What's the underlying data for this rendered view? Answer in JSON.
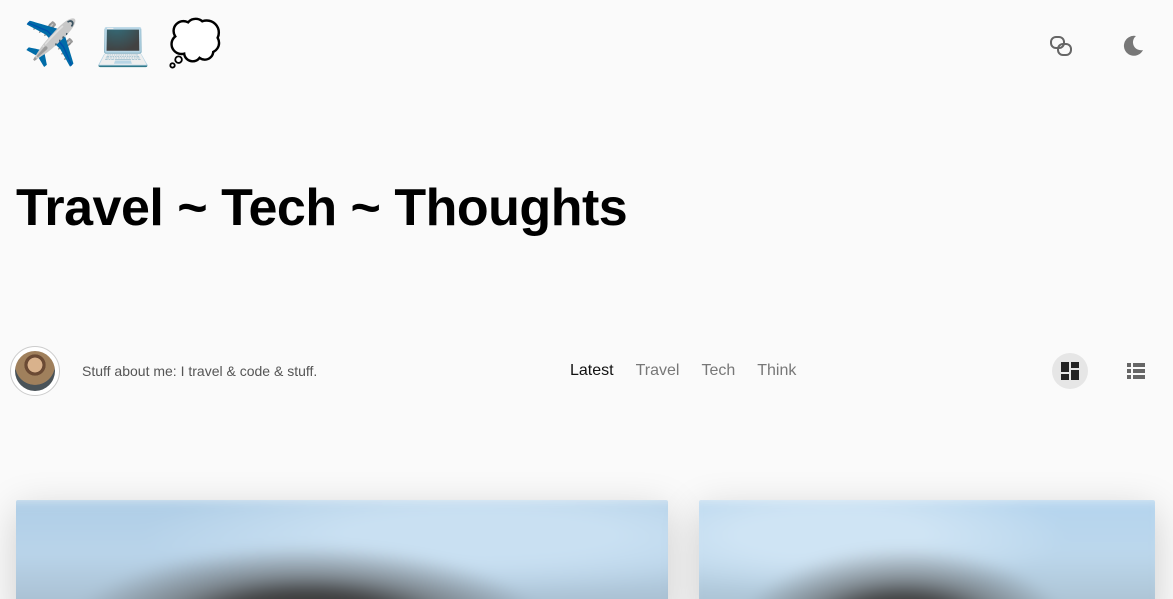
{
  "header": {
    "logo": [
      "✈️",
      "💻",
      "💭"
    ],
    "actions": [
      {
        "name": "link-icon"
      },
      {
        "name": "moon-icon"
      }
    ]
  },
  "site": {
    "title": "Travel ~ Tech ~ Thoughts"
  },
  "bio": {
    "text": "Stuff about me: I travel & code & stuff."
  },
  "tabs": [
    {
      "label": "Latest",
      "active": true
    },
    {
      "label": "Travel",
      "active": false
    },
    {
      "label": "Tech",
      "active": false
    },
    {
      "label": "Think",
      "active": false
    }
  ],
  "view_toggle": {
    "grid_icon": "grid-icon",
    "list_icon": "list-icon",
    "active": "grid"
  }
}
